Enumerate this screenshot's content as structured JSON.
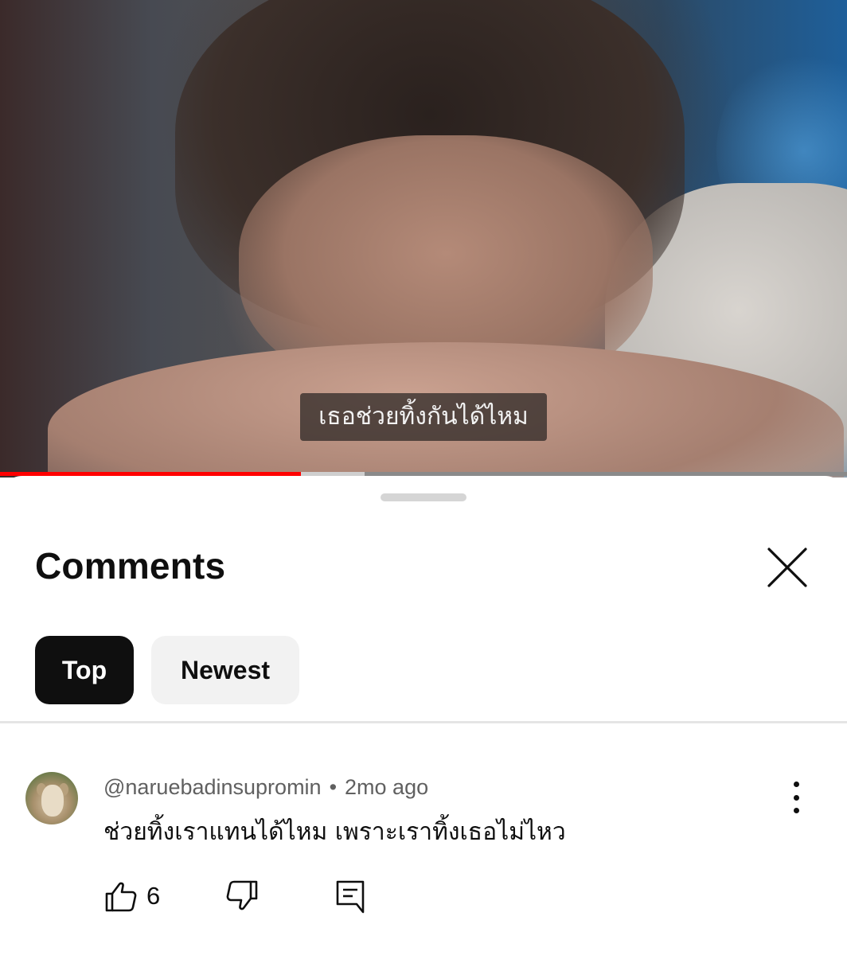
{
  "video": {
    "subtitle": "เธอช่วยทิ้งกันได้ไหม",
    "progress_played": 0.355,
    "progress_buffered": 0.43,
    "colors": {
      "played": "#ff0000",
      "buffered": "#cfcfcf",
      "track": "#8a8a8a"
    }
  },
  "comments_panel": {
    "title": "Comments",
    "close_icon": "close-icon",
    "filters": [
      {
        "label": "Top",
        "selected": true
      },
      {
        "label": "Newest",
        "selected": false
      }
    ]
  },
  "comment": {
    "author": "@naruebadinsupromin",
    "separator": "•",
    "age": "2mo ago",
    "text": "ช่วยทิ้งเราแทนได้ไหม เพราะเราทิ้งเธอไม่ไหว",
    "like_count": "6",
    "icons": [
      "thumbs-up-icon",
      "thumbs-down-icon",
      "reply-icon",
      "more-vertical-icon"
    ]
  }
}
